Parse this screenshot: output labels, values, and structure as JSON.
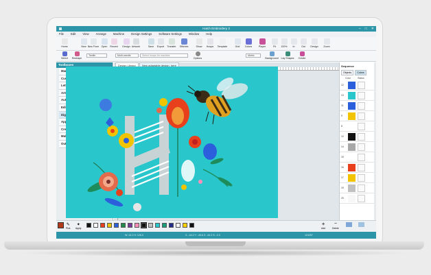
{
  "window": {
    "title": "Hatch Embroidery 3"
  },
  "menu": [
    "File",
    "Edit",
    "View",
    "Arrange",
    "Machine",
    "Design Settings",
    "Software Settings",
    "Window",
    "Help"
  ],
  "toolbar": {
    "row1": [
      "Home",
      "New",
      "New From",
      "Open",
      "Recent",
      "Design",
      "Artwork",
      "Save",
      "Export",
      "Transfer",
      "Stitches",
      "Show",
      "Hoops",
      "Template",
      "Grid",
      "Colors",
      "Player",
      "Fit",
      "100%",
      "In",
      "Out",
      "Design",
      "Zoom"
    ],
    "row2": [
      "Select",
      "Reshape",
      "Textile",
      "Multi-needle",
      "Select hoops for machine",
      "Options",
      "Metric",
      "Background",
      "Lay Shapes",
      "Create"
    ],
    "search_placeholder": "Select hoops for machine"
  },
  "sidebar": {
    "header": "Toolboxes",
    "items": [
      "Manage Designs",
      "Customize Design",
      "Lettering / Monogramming",
      "Artwork",
      "Auto-Digitize",
      "Edit Objects",
      "Digitize",
      "Applique",
      "Create Layouts",
      "Multi-Hooping",
      "Output Design"
    ],
    "active_index": 6
  },
  "tabs": [
    {
      "label": "Design Library"
    },
    {
      "label": "New adaptable design_here"
    }
  ],
  "sequence": {
    "title": "Sequence",
    "tabs": [
      "Objects",
      "Colors"
    ],
    "active_tab": 1,
    "columns": [
      "Color",
      "Status"
    ],
    "rows": [
      {
        "num": "12",
        "color": "#2b5fdc"
      },
      {
        "num": "13",
        "color": "#29c6cb"
      },
      {
        "num": "11",
        "color": "#2b5fdc"
      },
      {
        "num": "9",
        "color": "#f2c400"
      },
      {
        "num": "8",
        "color": "#ffffff"
      },
      {
        "num": "12",
        "color": "#111111"
      },
      {
        "num": "14",
        "color": "#a8a8a8"
      },
      {
        "num": "15",
        "color": "#ffffff"
      },
      {
        "num": "16",
        "color": "#e8401c"
      },
      {
        "num": "17",
        "color": "#f2c400"
      },
      {
        "num": "19",
        "color": "#c0c0c0"
      },
      {
        "num": "20",
        "color": "#f7f7f7"
      }
    ]
  },
  "colorbar": {
    "labels": [
      "Pick",
      "Apply",
      "Add",
      "Delete",
      "Mode",
      "Color"
    ],
    "swatches": [
      "#111111",
      "#ffffff",
      "#e8401c",
      "#f2c400",
      "#2b5fdc",
      "#1f8c4e",
      "#7a3a9a",
      "#ff8fb8",
      "#111111",
      "#c0c0c0",
      "#29c6cb",
      "#1c9e7a",
      "#222d8a",
      "#f5f5f5",
      "#ffd200",
      "#111111"
    ]
  },
  "statusbar": {
    "coords": "W: 44.2 H: 126.0",
    "dims": "X: -44.2 Y: -45.6 Z: -44.2 S: -2.0",
    "stitches": "115257"
  }
}
